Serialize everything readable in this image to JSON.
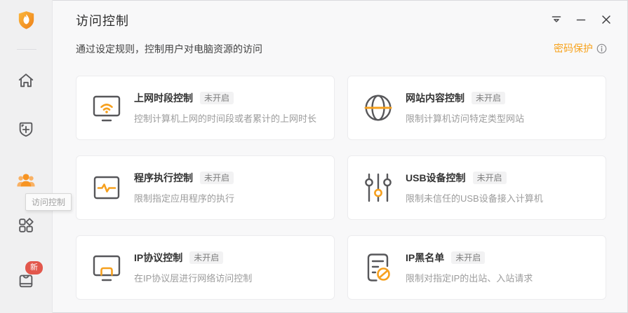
{
  "header": {
    "title": "访问控制",
    "subtitle": "通过设定规则，控制用户对电脑资源的访问",
    "password_protect_label": "密码保护",
    "password_info_icon": "info-circle-icon"
  },
  "window_controls": {
    "menu_icon": "main-menu-icon",
    "minimize_icon": "minimize-icon",
    "close_icon": "close-icon"
  },
  "sidebar": {
    "logo_icon": "shield-flame-logo",
    "items": [
      {
        "icon": "home-icon",
        "active": false
      },
      {
        "icon": "shield-plus-icon",
        "active": false
      },
      {
        "icon": "users-group-icon",
        "active": true,
        "tooltip": "访问控制"
      },
      {
        "icon": "app-grid-icon",
        "active": false
      },
      {
        "icon": "toolbox-icon",
        "active": false,
        "badge": "新"
      }
    ]
  },
  "cards": [
    {
      "icon": "monitor-wifi-icon",
      "title": "上网时段控制",
      "status": "未开启",
      "desc": "控制计算机上网的时间段或者累计的上网时长"
    },
    {
      "icon": "globe-icon",
      "title": "网站内容控制",
      "status": "未开启",
      "desc": "限制计算机访问特定类型网站"
    },
    {
      "icon": "window-pulse-icon",
      "title": "程序执行控制",
      "status": "未开启",
      "desc": "限制指定应用程序的执行"
    },
    {
      "icon": "sliders-icon",
      "title": "USB设备控制",
      "status": "未开启",
      "desc": "限制未信任的USB设备接入计算机"
    },
    {
      "icon": "monitor-window-icon",
      "title": "IP协议控制",
      "status": "未开启",
      "desc": "在IP协议层进行网络访问控制"
    },
    {
      "icon": "list-block-icon",
      "title": "IP黑名单",
      "status": "未开启",
      "desc": "限制对指定IP的出站、入站请求"
    }
  ],
  "colors": {
    "accent_orange": "#f7a01e",
    "password_link_orange": "#f7a21b",
    "new_badge_red": "#e2574c",
    "status_badge_bg": "#f2f2f3",
    "status_badge_text": "#7f7f7f",
    "sidebar_bg": "#f0f0f1",
    "main_bg": "#f8f8f9"
  }
}
